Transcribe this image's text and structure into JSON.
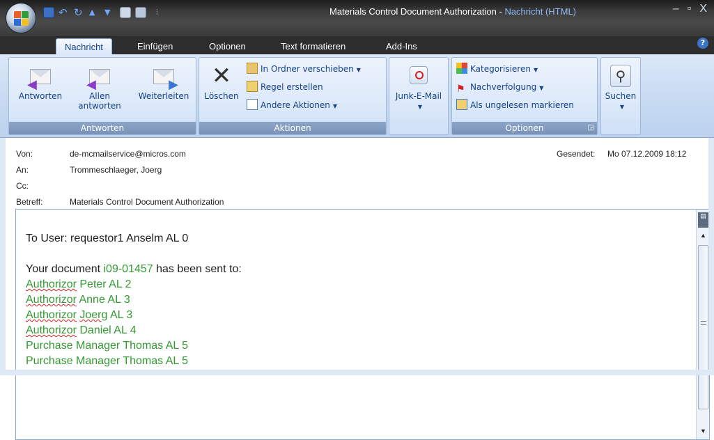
{
  "window": {
    "title": "Materials Control Document Authorization",
    "title_sep": " - ",
    "title_suffix": "Nachricht (HTML)",
    "minimize": "–",
    "maximize": "▫",
    "close": "X",
    "dropdown_glyph": "⫶"
  },
  "tabs": [
    {
      "label": "Nachricht",
      "active": true
    },
    {
      "label": "Einfügen"
    },
    {
      "label": "Optionen"
    },
    {
      "label": "Text formatieren"
    },
    {
      "label": "Add-Ins"
    }
  ],
  "help": "?",
  "ribbon": {
    "groups": {
      "antworten": "Antworten",
      "aktionen": "Aktionen",
      "optionen": "Optionen"
    },
    "buttons": {
      "antworten": "Antworten",
      "allen_line1": "Allen",
      "allen_line2": "antworten",
      "weiterleiten": "Weiterleiten",
      "loeschen": "Löschen",
      "in_ordner": "In Ordner verschieben",
      "regel": "Regel erstellen",
      "andere": "Andere Aktionen",
      "junk": "Junk-E-Mail",
      "kategorisieren": "Kategorisieren",
      "nachverfolgung": "Nachverfolgung",
      "ungelesen": "Als ungelesen markieren",
      "suchen": "Suchen"
    }
  },
  "header": {
    "von_label": "Von:",
    "von_value": "de-mcmailservice@micros.com",
    "an_label": "An:",
    "an_value": "Trommeschlaeger, Joerg",
    "cc_label": "Cc:",
    "cc_value": "",
    "betreff_label": "Betreff:",
    "betreff_value": "Materials Control Document Authorization",
    "gesendet_label": "Gesendet:",
    "gesendet_value": "Mo 07.12.2009 18:12"
  },
  "body": {
    "to_user": "To User: requestor1 Anselm AL 0",
    "doc_prefix": "Your document ",
    "doc_id": "i09-01457",
    "doc_suffix": " has been sent to:",
    "recipients": [
      {
        "role": "Authorizor",
        "rest": " Peter AL 2"
      },
      {
        "role": "Authorizor",
        "rest": " Anne AL 3"
      },
      {
        "role": "Authorizor",
        "name": "Joerg",
        "rest": " AL 3"
      },
      {
        "role": "Authorizor",
        "rest": " Daniel AL 4"
      }
    ],
    "managers": [
      "Purchase Manager Thomas AL 5",
      "Purchase Manager Thomas AL 5"
    ]
  },
  "colors": {
    "accent": "#15428b",
    "body_green": "#339933"
  }
}
